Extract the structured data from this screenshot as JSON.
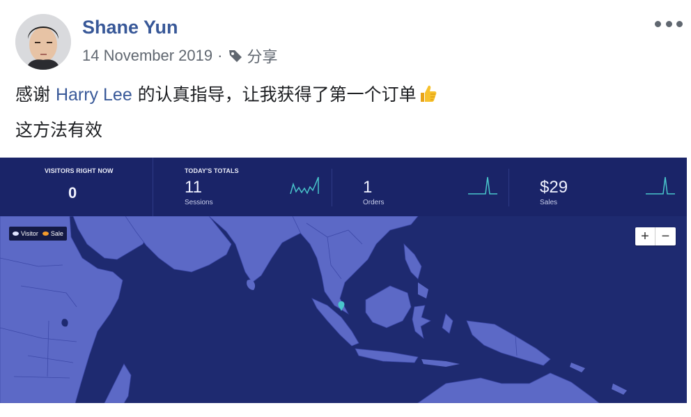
{
  "post": {
    "author": "Shane Yun",
    "date": "14 November 2019",
    "separator": "·",
    "audience_icon": "tag-icon",
    "audience": "分享",
    "menu_icon": "more-horizontal-icon",
    "text_line1_before": "感谢 ",
    "mention": "Harry Lee",
    "text_line1_after": " 的认真指导，让我获得了第一个订单",
    "emoji": "thumbs-up-icon",
    "text_line2": "这方法有效"
  },
  "dashboard": {
    "visitors_label": "VISITORS RIGHT NOW",
    "visitors_value": "0",
    "totals_label": "TODAY'S TOTALS",
    "sessions_value": "11",
    "sessions_label": "Sessions",
    "orders_value": "1",
    "orders_label": "Orders",
    "sales_value": "$29",
    "sales_label": "Sales",
    "legend_visitor": "Visitor",
    "legend_sale": "Sale",
    "zoom_in": "+",
    "zoom_out": "−"
  },
  "colors": {
    "link": "#385898",
    "dashboard_bg": "#1a2468",
    "land": "#5c69c6",
    "spark": "#49c6cc",
    "visitor_dot": "#e0e4ff",
    "sale_dot": "#f39a2b"
  }
}
